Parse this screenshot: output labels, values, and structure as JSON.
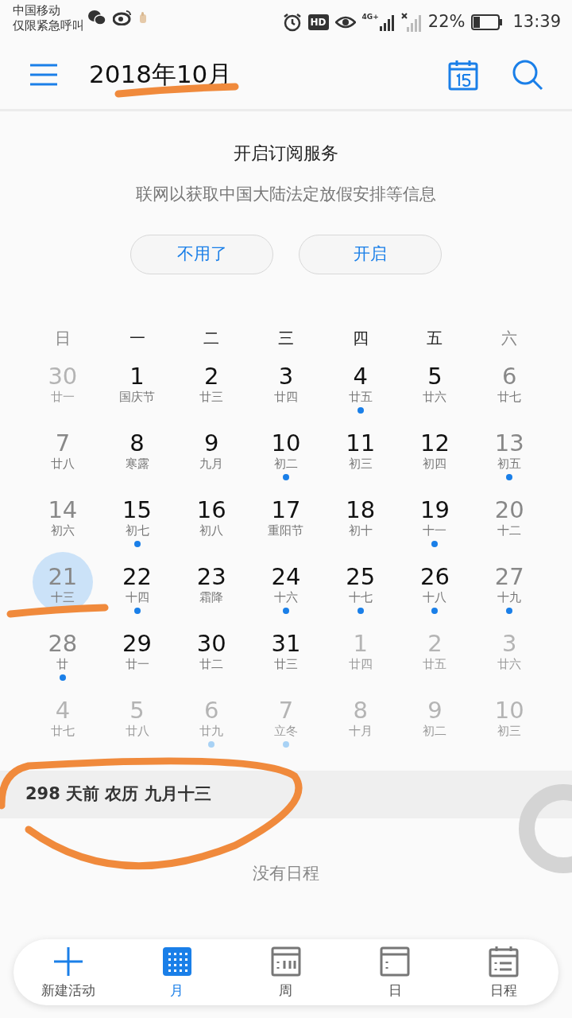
{
  "status_bar": {
    "carrier": "中国移动",
    "carrier_note": "仅限紧急呼叫",
    "hd": "HD",
    "network": "4G+",
    "battery_text": "22%",
    "time": "13:39"
  },
  "header": {
    "title": "2018年10月"
  },
  "subscription": {
    "title": "开启订阅服务",
    "subtitle": "联网以获取中国大陆法定放假安排等信息",
    "buttons": [
      "不用了",
      "开启"
    ]
  },
  "weekdays": [
    {
      "label": "日",
      "weekend": true
    },
    {
      "label": "一",
      "weekend": false
    },
    {
      "label": "二",
      "weekend": false
    },
    {
      "label": "三",
      "weekend": false
    },
    {
      "label": "四",
      "weekend": false
    },
    {
      "label": "五",
      "weekend": false
    },
    {
      "label": "六",
      "weekend": true
    }
  ],
  "weeks": [
    [
      {
        "day": "30",
        "lunar": "廿一",
        "kind": "other",
        "dot": false,
        "selected": false
      },
      {
        "day": "1",
        "lunar": "国庆节",
        "kind": "weekday",
        "dot": false,
        "selected": false
      },
      {
        "day": "2",
        "lunar": "廿三",
        "kind": "weekday",
        "dot": false,
        "selected": false
      },
      {
        "day": "3",
        "lunar": "廿四",
        "kind": "weekday",
        "dot": false,
        "selected": false
      },
      {
        "day": "4",
        "lunar": "廿五",
        "kind": "weekday",
        "dot": true,
        "selected": false
      },
      {
        "day": "5",
        "lunar": "廿六",
        "kind": "weekday",
        "dot": false,
        "selected": false
      },
      {
        "day": "6",
        "lunar": "廿七",
        "kind": "weekend",
        "dot": false,
        "selected": false
      }
    ],
    [
      {
        "day": "7",
        "lunar": "廿八",
        "kind": "weekend",
        "dot": false,
        "selected": false
      },
      {
        "day": "8",
        "lunar": "寒露",
        "kind": "weekday",
        "dot": false,
        "selected": false
      },
      {
        "day": "9",
        "lunar": "九月",
        "kind": "weekday",
        "dot": false,
        "selected": false
      },
      {
        "day": "10",
        "lunar": "初二",
        "kind": "weekday",
        "dot": true,
        "selected": false
      },
      {
        "day": "11",
        "lunar": "初三",
        "kind": "weekday",
        "dot": false,
        "selected": false
      },
      {
        "day": "12",
        "lunar": "初四",
        "kind": "weekday",
        "dot": false,
        "selected": false
      },
      {
        "day": "13",
        "lunar": "初五",
        "kind": "weekend",
        "dot": true,
        "selected": false
      }
    ],
    [
      {
        "day": "14",
        "lunar": "初六",
        "kind": "weekend",
        "dot": false,
        "selected": false
      },
      {
        "day": "15",
        "lunar": "初七",
        "kind": "weekday",
        "dot": true,
        "selected": false
      },
      {
        "day": "16",
        "lunar": "初八",
        "kind": "weekday",
        "dot": false,
        "selected": false
      },
      {
        "day": "17",
        "lunar": "重阳节",
        "kind": "weekday",
        "dot": false,
        "selected": false
      },
      {
        "day": "18",
        "lunar": "初十",
        "kind": "weekday",
        "dot": false,
        "selected": false
      },
      {
        "day": "19",
        "lunar": "十一",
        "kind": "weekday",
        "dot": true,
        "selected": false
      },
      {
        "day": "20",
        "lunar": "十二",
        "kind": "weekend",
        "dot": false,
        "selected": false
      }
    ],
    [
      {
        "day": "21",
        "lunar": "十三",
        "kind": "weekend",
        "dot": false,
        "selected": true
      },
      {
        "day": "22",
        "lunar": "十四",
        "kind": "weekday",
        "dot": true,
        "selected": false
      },
      {
        "day": "23",
        "lunar": "霜降",
        "kind": "weekday",
        "dot": false,
        "selected": false
      },
      {
        "day": "24",
        "lunar": "十六",
        "kind": "weekday",
        "dot": true,
        "selected": false
      },
      {
        "day": "25",
        "lunar": "十七",
        "kind": "weekday",
        "dot": true,
        "selected": false
      },
      {
        "day": "26",
        "lunar": "十八",
        "kind": "weekday",
        "dot": true,
        "selected": false
      },
      {
        "day": "27",
        "lunar": "十九",
        "kind": "weekend",
        "dot": true,
        "selected": false
      }
    ],
    [
      {
        "day": "28",
        "lunar": "廿",
        "kind": "weekend",
        "dot": true,
        "selected": false
      },
      {
        "day": "29",
        "lunar": "廿一",
        "kind": "weekday",
        "dot": false,
        "selected": false
      },
      {
        "day": "30",
        "lunar": "廿二",
        "kind": "weekday",
        "dot": false,
        "selected": false
      },
      {
        "day": "31",
        "lunar": "廿三",
        "kind": "weekday",
        "dot": false,
        "selected": false
      },
      {
        "day": "1",
        "lunar": "廿四",
        "kind": "other",
        "dot": false,
        "selected": false
      },
      {
        "day": "2",
        "lunar": "廿五",
        "kind": "other",
        "dot": false,
        "selected": false
      },
      {
        "day": "3",
        "lunar": "廿六",
        "kind": "other",
        "dot": false,
        "selected": false
      }
    ],
    [
      {
        "day": "4",
        "lunar": "廿七",
        "kind": "other",
        "dot": false,
        "selected": false
      },
      {
        "day": "5",
        "lunar": "廿八",
        "kind": "other",
        "dot": false,
        "selected": false
      },
      {
        "day": "6",
        "lunar": "廿九",
        "kind": "other",
        "dot": true,
        "selected": false
      },
      {
        "day": "7",
        "lunar": "立冬",
        "kind": "other",
        "dot": true,
        "selected": false
      },
      {
        "day": "8",
        "lunar": "十月",
        "kind": "other",
        "dot": false,
        "selected": false
      },
      {
        "day": "9",
        "lunar": "初二",
        "kind": "other",
        "dot": false,
        "selected": false
      },
      {
        "day": "10",
        "lunar": "初三",
        "kind": "other",
        "dot": false,
        "selected": false
      }
    ]
  ],
  "info": {
    "text": "298 天前  农历 九月十三"
  },
  "empty_text": "没有日程",
  "nav": [
    {
      "kind": "add",
      "label": "新建活动",
      "selected": false
    },
    {
      "kind": "month",
      "label": "月",
      "selected": true
    },
    {
      "kind": "week",
      "label": "周",
      "selected": false
    },
    {
      "kind": "day",
      "label": "日",
      "selected": false
    },
    {
      "kind": "agenda",
      "label": "日程",
      "selected": false
    }
  ]
}
